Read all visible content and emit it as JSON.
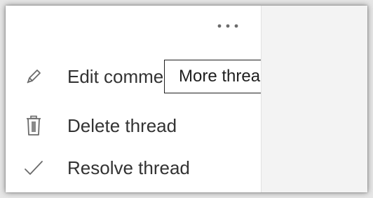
{
  "menu": {
    "more_icon": "ellipsis-icon",
    "items": [
      {
        "label": "Edit comment",
        "icon": "pencil-icon"
      },
      {
        "label": "Delete thread",
        "icon": "trash-icon"
      },
      {
        "label": "Resolve thread",
        "icon": "checkmark-icon"
      }
    ]
  },
  "tooltip": {
    "text": "More thread actions"
  },
  "colors": {
    "text": "#333333",
    "icon": "#6b6b6b",
    "tooltip_border": "#1f1f1f",
    "panel_bg": "#ffffff",
    "pane_bg": "#f3f3f3"
  }
}
